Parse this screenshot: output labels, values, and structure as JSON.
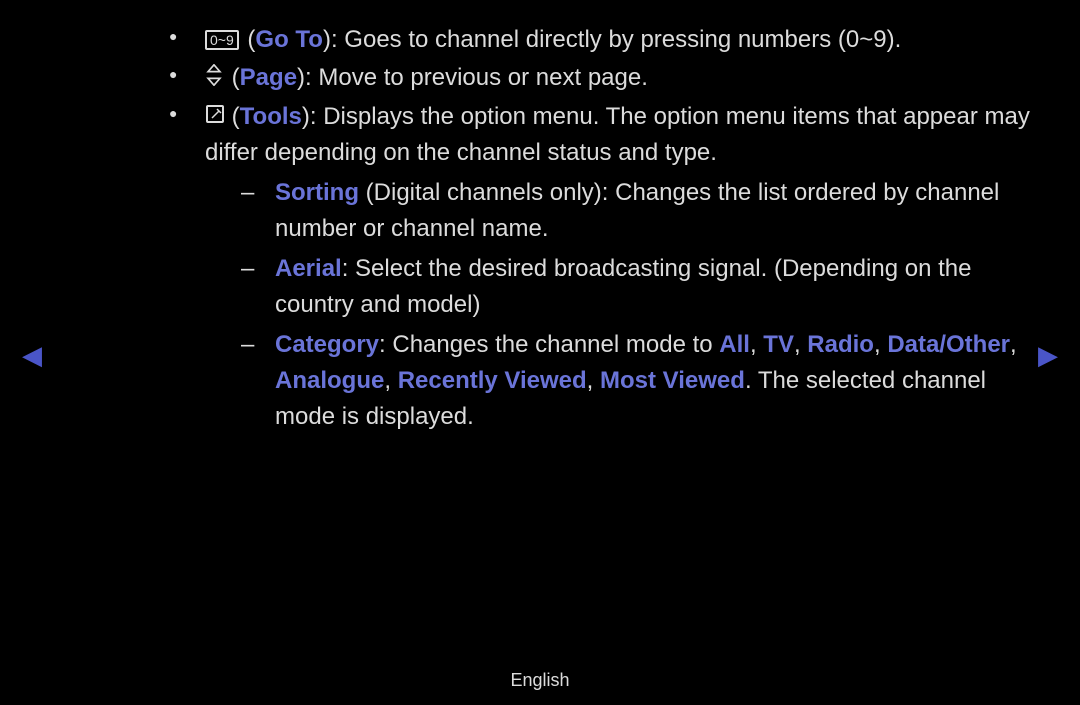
{
  "items": [
    {
      "icon_label": "0~9",
      "label": "Go To",
      "desc": "Goes to channel directly by pressing numbers (0~9)."
    },
    {
      "label": "Page",
      "desc": "Move to previous or next page."
    },
    {
      "label": "Tools",
      "desc_a": "Displays the option menu. The option menu items that appear may differ depending on the channel status and type.",
      "sub": [
        {
          "label": "Sorting",
          "desc": " (Digital channels only): Changes the list ordered by channel number or channel name."
        },
        {
          "label": "Aerial",
          "desc": ": Select the desired broadcasting signal. (Depending on the country and model)"
        },
        {
          "label": "Category",
          "desc_pre": ": Changes the channel mode to ",
          "opts": [
            "All",
            "TV",
            "Radio",
            "Data/Other",
            "Analogue",
            "Recently Viewed",
            "Most Viewed"
          ],
          "sep": ", ",
          "desc_post": ". The selected channel mode is displayed."
        }
      ]
    }
  ],
  "footer": "English"
}
